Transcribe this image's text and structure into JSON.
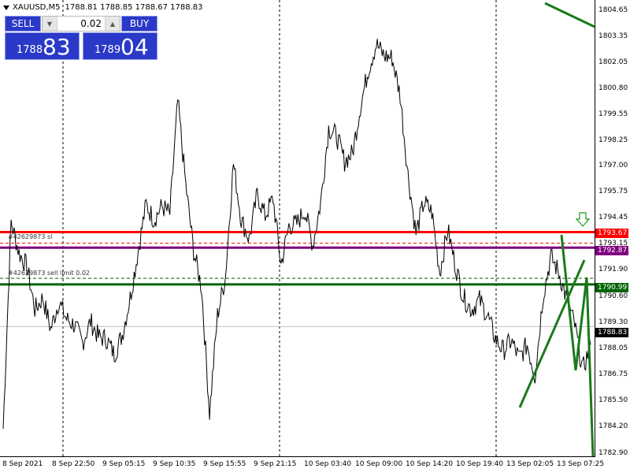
{
  "header": {
    "symbol": "XAUUSD,M5",
    "ohlc": "1788.81 1788.85 1788.67 1788.83"
  },
  "trade_panel": {
    "sell_label": "SELL",
    "buy_label": "BUY",
    "lot": "0.02",
    "sell_price_small": "1788",
    "sell_price_big": "83",
    "buy_price_small": "1789",
    "buy_price_big": "04"
  },
  "price_axis": [
    "1804.65",
    "1803.35",
    "1802.05",
    "1800.80",
    "1799.55",
    "1798.25",
    "1797.00",
    "1795.75",
    "1794.45",
    "1793.15",
    "1791.90",
    "1790.60",
    "1789.30",
    "1788.05",
    "1786.75",
    "1785.50",
    "1784.20",
    "1782.90"
  ],
  "time_axis": [
    "8 Sep 2021",
    "8 Sep 22:50",
    "9 Sep 05:15",
    "9 Sep 10:35",
    "9 Sep 15:55",
    "9 Sep 21:15",
    "10 Sep 03:40",
    "10 Sep 09:00",
    "10 Sep 14:20",
    "10 Sep 19:40",
    "13 Sep 02:05",
    "13 Sep 07:25"
  ],
  "levels": {
    "red": {
      "price": "1793.67",
      "color": "#ff0000"
    },
    "purple": {
      "price": "1792.87",
      "color": "#800080"
    },
    "green": {
      "price": "1790.99",
      "color": "#006400"
    },
    "current": {
      "price": "1788.83",
      "color": "#000000"
    }
  },
  "order_notes": {
    "sl_note": "#42629873 sl",
    "limit_note": "#42629873 sell limit 0.02"
  },
  "chart_data": {
    "type": "line",
    "title": "XAUUSD,M5",
    "ylim": [
      1782.3,
      1805.0
    ],
    "x": [
      "8 Sep 2021",
      "8 Sep 22:50",
      "9 Sep 05:15",
      "9 Sep 10:35",
      "9 Sep 15:55",
      "9 Sep 21:15",
      "10 Sep 03:40",
      "10 Sep 09:00",
      "10 Sep 14:20",
      "10 Sep 19:40",
      "13 Sep 02:05",
      "13 Sep 07:25"
    ],
    "series": [
      {
        "values": [
          1783.6,
          1794.2,
          1792.6,
          1791.9,
          1789.7,
          1790.3,
          1788.7,
          1790.1,
          1789.2,
          1788.9,
          1788.0,
          1789.1,
          1788.3,
          1788.2,
          1787.4,
          1788.4,
          1790.3,
          1792.7,
          1795.1,
          1794.3,
          1795.0,
          1794.6,
          1800.4,
          1796.1,
          1792.7,
          1790.8,
          1784.4,
          1789.4,
          1791.4,
          1797.2,
          1794.3,
          1793.3,
          1795.6,
          1794.5,
          1795.4,
          1792.0,
          1794.0,
          1794.1,
          1794.8,
          1793.0,
          1795.2,
          1799.0,
          1798.6,
          1797.3,
          1797.7,
          1800.1,
          1802.0,
          1803.3,
          1802.7,
          1802.6,
          1800.7,
          1796.6,
          1793.6,
          1795.2,
          1794.7,
          1791.6,
          1793.8,
          1791.9,
          1790.3,
          1789.7,
          1790.2,
          1789.4,
          1788.2,
          1787.6,
          1788.1,
          1787.2,
          1787.9,
          1786.3,
          1790.4,
          1792.4,
          1791.6,
          1790.2,
          1788.9,
          1786.6,
          1787.9
        ]
      }
    ],
    "lines": {
      "resistance": 1793.67,
      "purple": 1792.87,
      "support": 1790.99,
      "current": 1788.83
    }
  }
}
